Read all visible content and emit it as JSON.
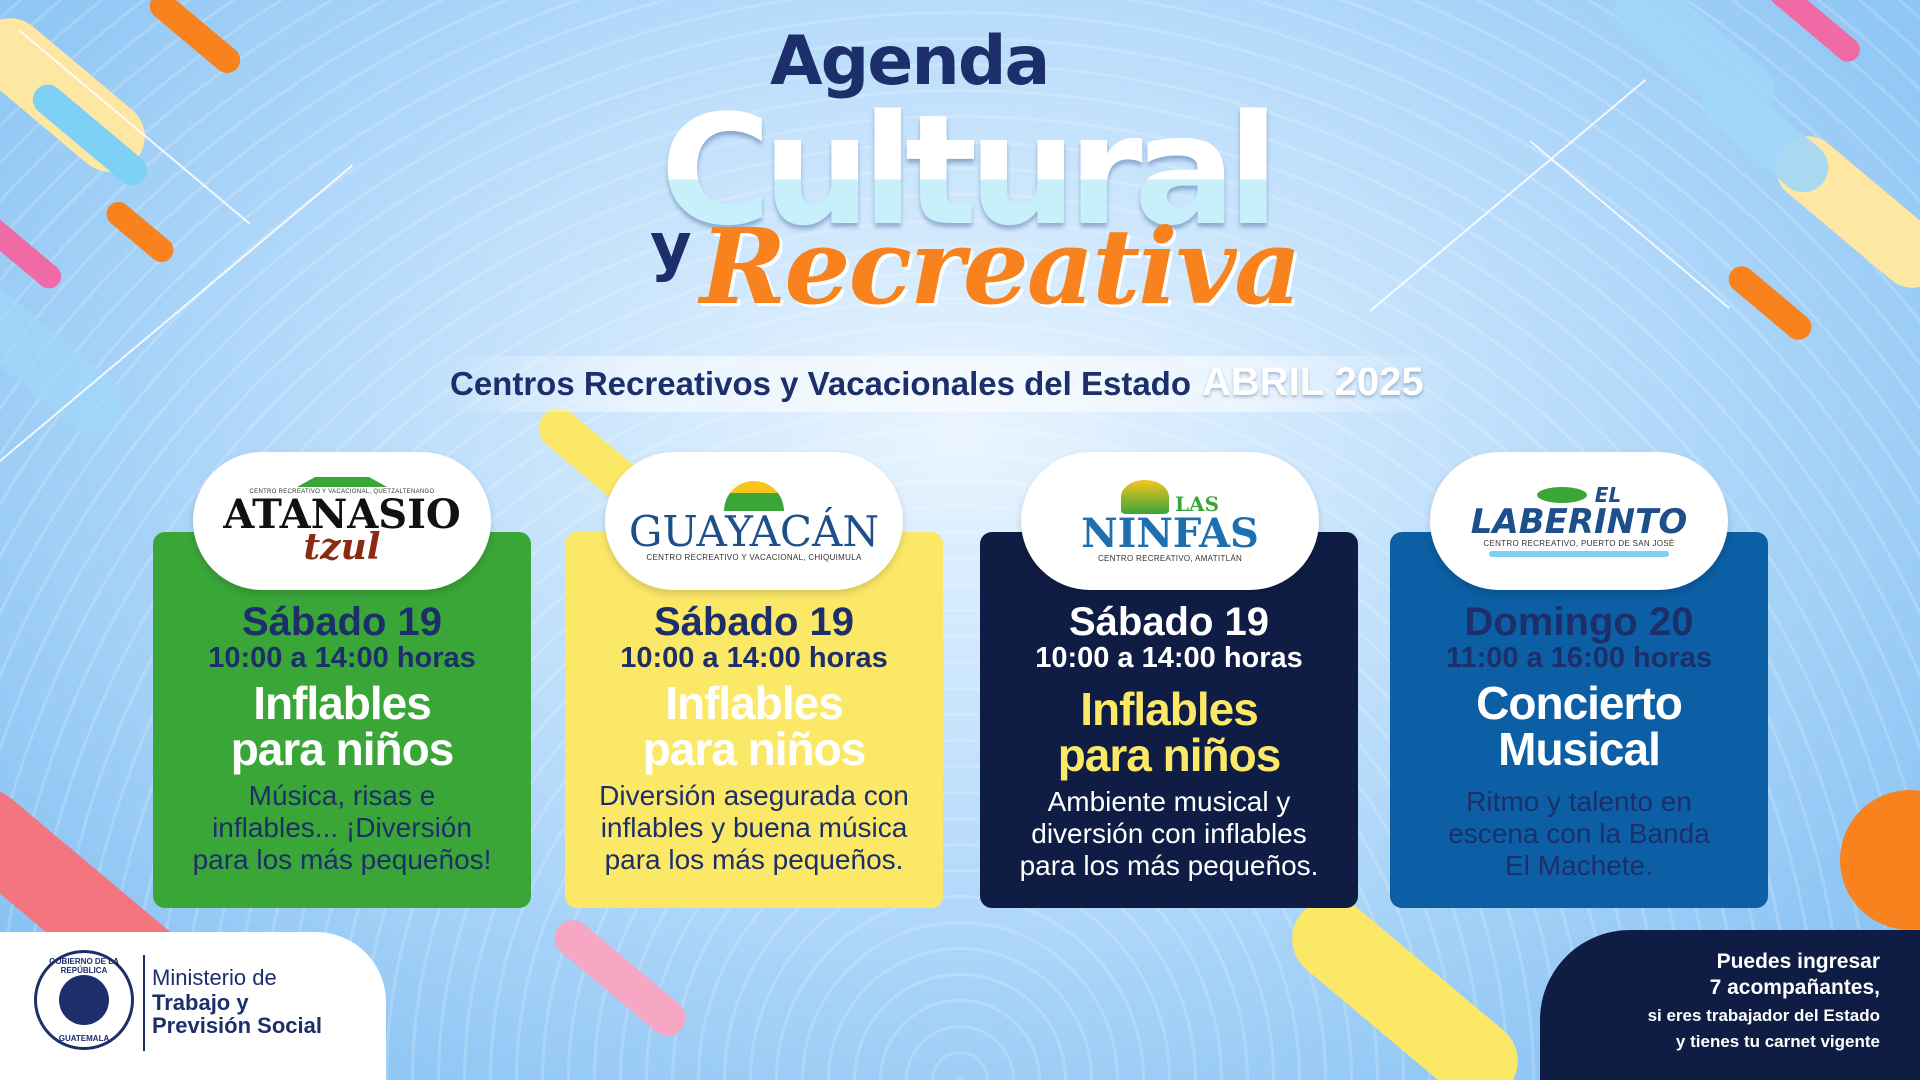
{
  "header": {
    "title_line1": "Agenda",
    "title_line2": "Cultural",
    "title_connector": "y",
    "title_line3": "Recreativa",
    "subtitle": "Centros Recreativos y Vacacionales del Estado",
    "date": "ABRIL 2025"
  },
  "cards": [
    {
      "logo": {
        "top_text": "CENTRO RECREATIVO Y VACACIONAL, QUETZALTENANGO",
        "name_line1": "ATANASIO",
        "name_line2": "tzul"
      },
      "day": "Sábado 19",
      "hours": "10:00 a 14:00 horas",
      "event_line1": "Inflables",
      "event_line2": "para niños",
      "description_line1": "Música, risas e",
      "description_line2": "inflables... ¡Diversión",
      "description_line3": "para los más pequeños!",
      "colors": {
        "bg": "#3aa638",
        "title": "#1d2f6b",
        "event": "#ffffff",
        "desc": "#1d2f6b"
      }
    },
    {
      "logo": {
        "name": "GUAYACÁN",
        "bottom_text": "CENTRO RECREATIVO Y VACACIONAL, CHIQUIMULA"
      },
      "day": "Sábado 19",
      "hours": "10:00 a 14:00 horas",
      "event_line1": "Inflables",
      "event_line2": "para niños",
      "description_line1": "Diversión asegurada con",
      "description_line2": "inflables y buena música",
      "description_line3": "para los más pequeños.",
      "colors": {
        "bg": "#fce867",
        "title": "#1d2f6b",
        "event": "#ffffff",
        "desc": "#1d2f6b"
      }
    },
    {
      "logo": {
        "name_line1": "LAS",
        "name_line2": "NINFAS",
        "bottom_text": "CENTRO RECREATIVO, AMATITLÁN"
      },
      "day": "Sábado 19",
      "hours": "10:00 a 14:00 horas",
      "event_line1": "Inflables",
      "event_line2": "para niños",
      "description_line1": "Ambiente musical y",
      "description_line2": "diversión con inflables",
      "description_line3": "para los más pequeños.",
      "colors": {
        "bg": "#0f1d45",
        "title": "#ffffff",
        "event": "#fce867",
        "desc": "#ffffff"
      }
    },
    {
      "logo": {
        "name_line1": "EL",
        "name_line2": "LABERINTO",
        "bottom_text": "CENTRO RECREATIVO, PUERTO DE SAN JOSÉ"
      },
      "day": "Domingo 20",
      "hours": "11:00 a 16:00 horas",
      "event_line1": "Concierto",
      "event_line2": "Musical",
      "description_line1": "Ritmo y talento en",
      "description_line2": "escena con la Banda",
      "description_line3": "El Machete.",
      "colors": {
        "bg": "#0c5fa4",
        "title": "#1d2f6b",
        "event": "#ffffff",
        "desc": "#1d2f6b"
      }
    }
  ],
  "footer": {
    "seal_top": "GOBIERNO DE LA REPÚBLICA",
    "seal_bottom": "GUATEMALA",
    "ministry_line1": "Ministerio de",
    "ministry_line2": "Trabajo y",
    "ministry_line3": "Previsión Social",
    "note_line1": "Puedes ingresar",
    "note_line2": "7 acompañantes,",
    "note_line3": "si eres trabajador del Estado",
    "note_line4": "y tienes tu carnet vigente"
  },
  "palette": {
    "navy": "#1d2f6b",
    "orange": "#f7821e",
    "green": "#3aa638",
    "yellow": "#fce867",
    "blue": "#0c5fa4",
    "dark": "#0f1d45"
  }
}
